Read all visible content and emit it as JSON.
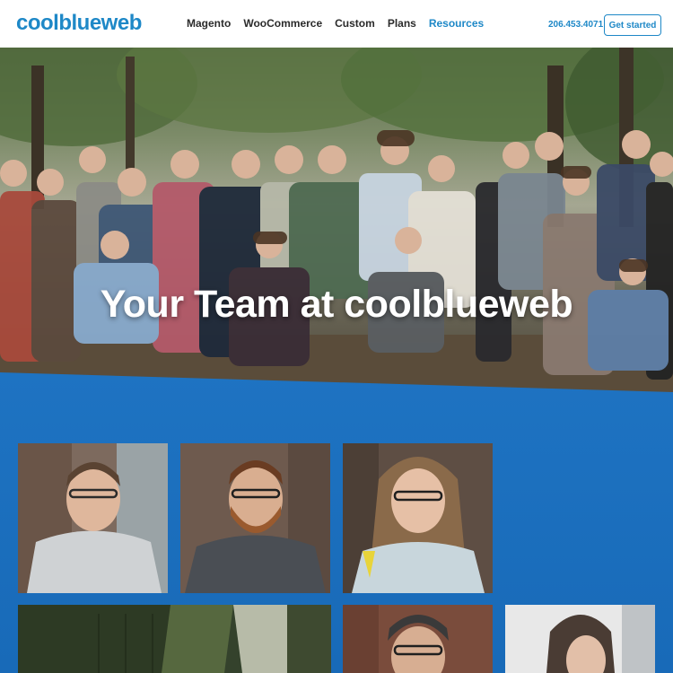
{
  "header": {
    "logo": "coolblueweb",
    "nav": [
      {
        "label": "Magento",
        "active": false
      },
      {
        "label": "WooCommerce",
        "active": false
      },
      {
        "label": "Custom",
        "active": false
      },
      {
        "label": "Plans",
        "active": false
      },
      {
        "label": "Resources",
        "active": true
      }
    ],
    "phone": "206.453.4071",
    "cta_label": "Get started"
  },
  "hero": {
    "title": "Your Team at coolblueweb"
  },
  "colors": {
    "brand_blue": "#1e88c7",
    "band_blue": "#1e73c2"
  }
}
